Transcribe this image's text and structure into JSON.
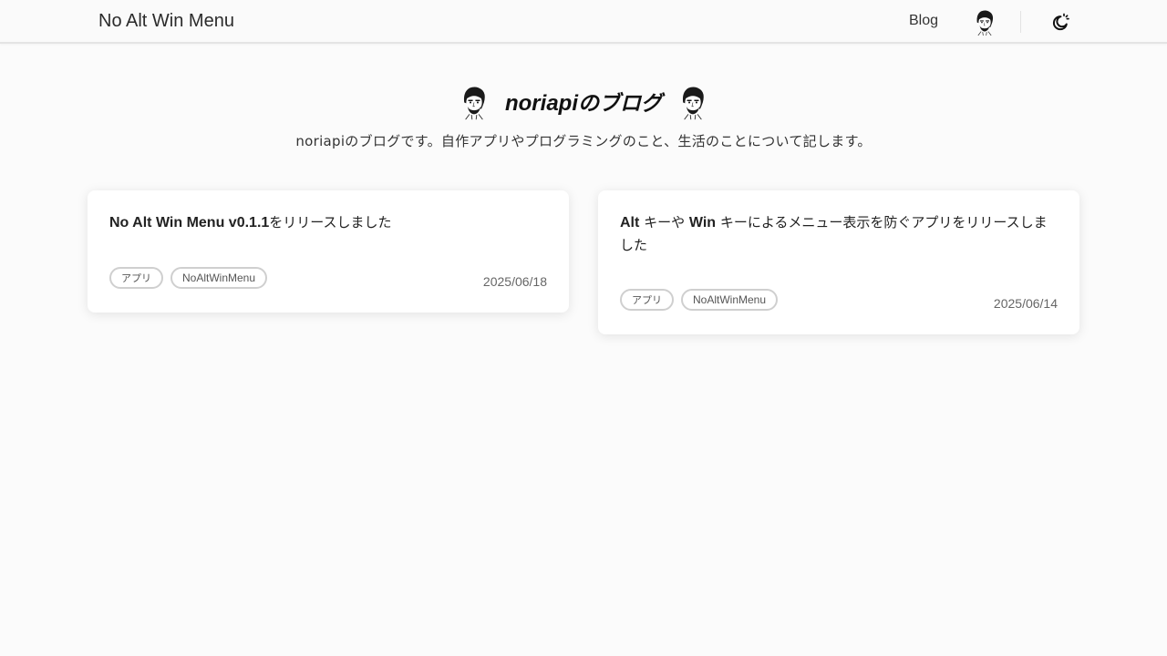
{
  "nav": {
    "brand": "No Alt Win Menu",
    "blog_label": "Blog",
    "avatar_icon": "author-face-icon",
    "theme_icon": "moon-sun-theme-icon"
  },
  "hero": {
    "title_latin": "noriapi",
    "title_jp": "のブログ",
    "tagline": "noriapiのブログです。自作アプリやプログラミングのこと、生活のことについて記します。",
    "face_icon": "author-face-icon"
  },
  "posts": [
    {
      "title_bold": "No Alt Win Menu v0.1.1",
      "title_rest": "をリリースしました",
      "tags": [
        "アプリ",
        "NoAltWinMenu"
      ],
      "date": "2025/06/18"
    },
    {
      "title_parts": [
        {
          "text": "Alt",
          "bold": true
        },
        {
          "text": " キーや ",
          "bold": false
        },
        {
          "text": "Win",
          "bold": true
        },
        {
          "text": " キーによるメニュー表示を防ぐアプリをリリースしました",
          "bold": false
        }
      ],
      "tags": [
        "アプリ",
        "NoAltWinMenu"
      ],
      "date": "2025/06/14"
    }
  ]
}
